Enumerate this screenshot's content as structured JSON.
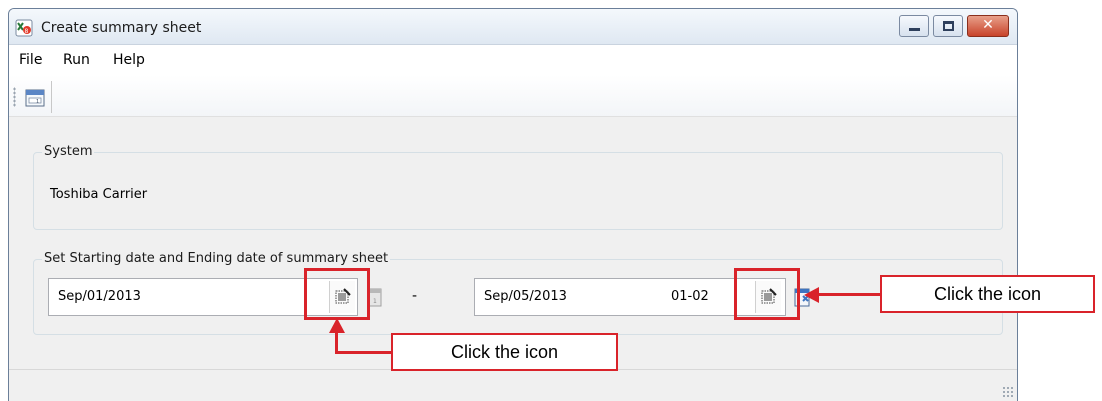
{
  "window": {
    "title": "Create summary sheet",
    "buttons": {
      "minimize": "minimize",
      "maximize": "maximize",
      "close": "close"
    }
  },
  "menu": [
    "File",
    "Run",
    "Help"
  ],
  "toolbar": {
    "icon": "calendar-sheet-icon"
  },
  "system_group": {
    "label": "System",
    "value": "Toshiba Carrier"
  },
  "date_group": {
    "label": "Set Starting date and Ending date of summary sheet",
    "start_date": "Sep/01/2013",
    "separator": "-",
    "end_date": "Sep/05/2013",
    "end_time": "01-02"
  },
  "annotations": {
    "callout_right": "Click the icon",
    "callout_bottom": "Click the icon",
    "color": "#d9232a"
  }
}
